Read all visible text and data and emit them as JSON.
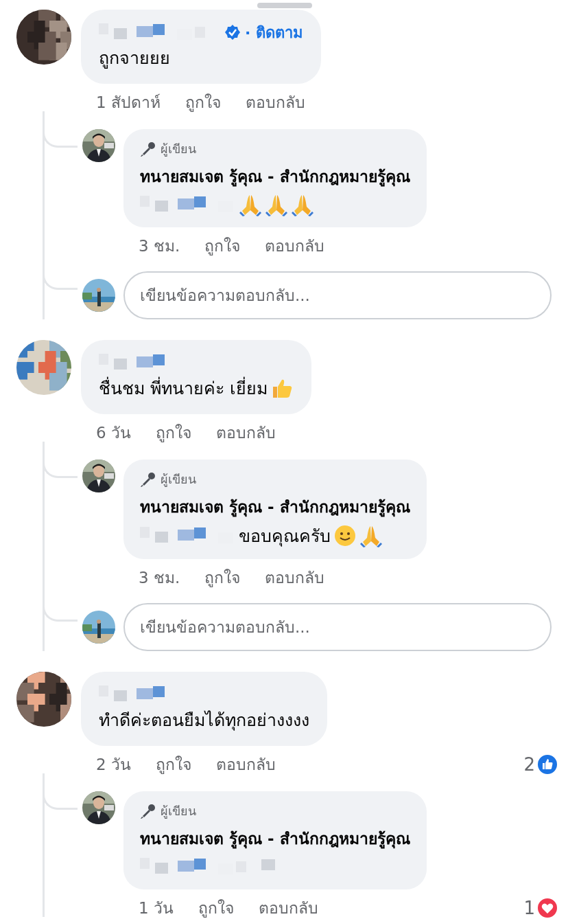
{
  "threads": [
    {
      "comment": {
        "verified": true,
        "follow": "· ติดตาม",
        "text": "ถูกจายยย",
        "time": "1 สัปดาห์",
        "like": "ถูกใจ",
        "reply": "ตอบกลับ"
      },
      "replies": [
        {
          "badge": "ผู้เขียน",
          "author": "ทนายสมเจต รู้คุณ - สำนักกฎหมายรู้คุณ",
          "emojis": [
            {
              "kind": "pray"
            },
            {
              "kind": "pray"
            },
            {
              "kind": "pray"
            }
          ],
          "time": "3 ชม.",
          "like": "ถูกใจ",
          "reply": "ตอบกลับ"
        }
      ],
      "reply_box": {
        "placeholder": "เขียนข้อความตอบกลับ..."
      }
    },
    {
      "comment": {
        "text": "ชื่นชม พี่ทนายค่ะ เยี่ยม",
        "emojis": [
          {
            "kind": "thumbs"
          }
        ],
        "time": "6 วัน",
        "like": "ถูกใจ",
        "reply": "ตอบกลับ"
      },
      "replies": [
        {
          "badge": "ผู้เขียน",
          "author": "ทนายสมเจต รู้คุณ - สำนักกฎหมายรู้คุณ",
          "text": "ขอบคุณครับ",
          "emojis": [
            {
              "kind": "smile"
            },
            {
              "kind": "pray"
            }
          ],
          "time": "3 ชม.",
          "like": "ถูกใจ",
          "reply": "ตอบกลับ"
        }
      ],
      "reply_box": {
        "placeholder": "เขียนข้อความตอบกลับ..."
      }
    },
    {
      "comment": {
        "text": "ทำดีค่ะตอนยืมได้ทุกอย่างงงง",
        "time": "2 วัน",
        "like": "ถูกใจ",
        "reply": "ตอบกลับ",
        "reactions": {
          "count": "2",
          "kind": "like"
        }
      },
      "replies": [
        {
          "badge": "ผู้เขียน",
          "author": "ทนายสมเจต รู้คุณ - สำนักกฎหมายรู้คุณ",
          "time": "1 วัน",
          "like": "ถูกใจ",
          "reply": "ตอบกลับ",
          "reactions": {
            "count": "1",
            "kind": "love"
          }
        }
      ]
    }
  ]
}
